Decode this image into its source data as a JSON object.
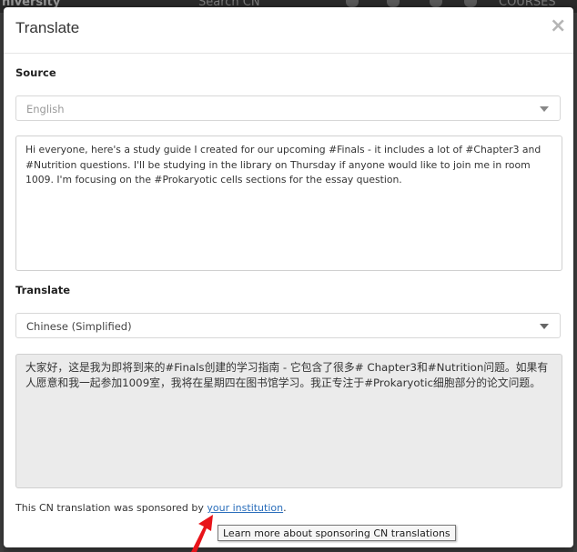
{
  "background": {
    "brand": "niversity",
    "search_placeholder": "Search CN",
    "courses_label": "COURSES"
  },
  "modal": {
    "title": "Translate",
    "close_glyph": "×",
    "source_label": "Source",
    "source_language": "English",
    "source_text": "Hi everyone, here's a study guide I created for our upcoming #Finals - it includes a lot of #Chapter3 and #Nutrition questions. I'll be studying in the library on Thursday if anyone would like to join me in room 1009. I'm focusing on the #Prokaryotic cells sections for the essay question.",
    "translate_label": "Translate",
    "target_language": "Chinese (Simplified)",
    "translated_text": "大家好，这是我为即将到来的#Finals创建的学习指南 - 它包含了很多# Chapter3和#Nutrition问题。如果有人愿意和我一起参加1009室，我将在星期四在图书馆学习。我正专注于#Prokaryotic细胞部分的论文问题。",
    "footer_prefix": "This CN translation was sponsored by ",
    "footer_link": "your institution",
    "footer_suffix": ".",
    "tooltip": "Learn more about sponsoring CN translations"
  },
  "colors": {
    "link": "#2a6ebb",
    "arrow": "#e8141a",
    "output_bg": "#ebebeb"
  }
}
